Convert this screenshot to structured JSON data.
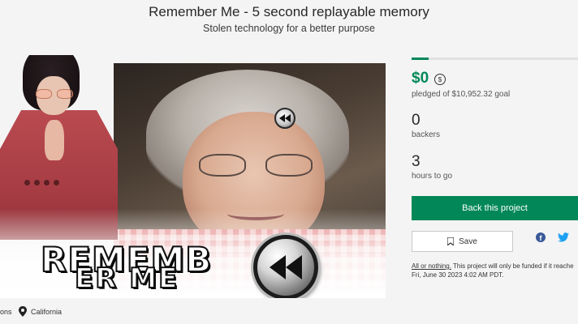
{
  "header": {
    "title": "Remember Me - 5 second replayable memory",
    "subtitle": "Stolen technology for a better purpose"
  },
  "media": {
    "overlay_text_line1": "REMEMB",
    "overlay_text_line2": "ER ME",
    "logo_icon": "rewind-icon",
    "implant_icon": "rewind-icon"
  },
  "meta": {
    "category": "ons",
    "location": "California",
    "location_icon": "map-pin-icon"
  },
  "campaign": {
    "progress_fraction": 0.1,
    "pledged": "$0",
    "currency_icon": "currency-conversion-icon",
    "goal_text": "pledged of $10,952.32 goal",
    "backers_count": "0",
    "backers_label": "backers",
    "hours_count": "3",
    "hours_label": "hours to go",
    "back_button": "Back this project",
    "save_button": "Save",
    "facebook_icon": "f",
    "twitter_icon": "twitter-icon",
    "funding_link": "All or nothing.",
    "funding_text": " This project will only be funded if it reache",
    "funding_deadline": "Fri, June 30 2023 4:02 AM PDT."
  },
  "colors": {
    "accent": "#028858",
    "facebook": "#3a5998",
    "twitter": "#1da1f2"
  }
}
